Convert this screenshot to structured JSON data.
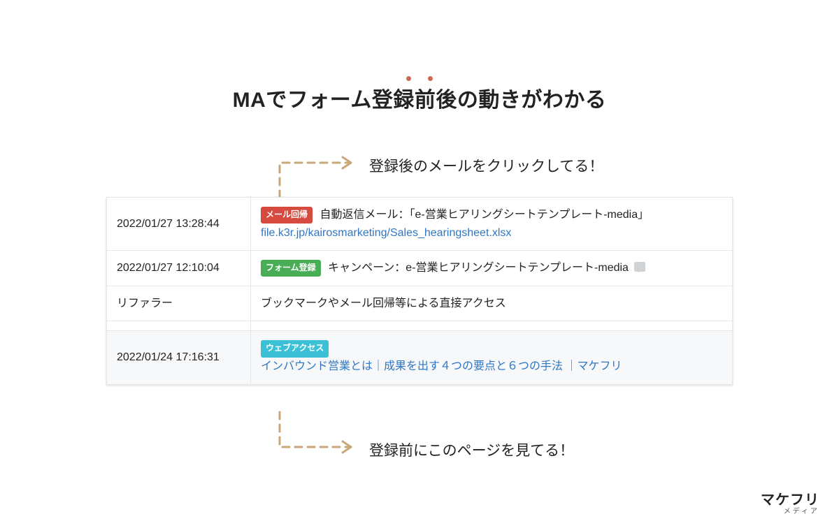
{
  "title": "MAでフォーム登録前後の動きがわかる",
  "annotations": {
    "top": "登録後のメールをクリックしてる！",
    "bottom": "登録前にこのページを見てる！"
  },
  "tags": {
    "mail_return": "メール回帰",
    "form_register": "フォーム登録",
    "web_access": "ウェブアクセス"
  },
  "rows": {
    "r1": {
      "ts": "2022/01/27 13:28:44",
      "desc": "自動返信メール：「e-営業ヒアリングシートテンプレート-media」",
      "link": "file.k3r.jp/kairosmarketing/Sales_hearingsheet.xlsx"
    },
    "r2": {
      "ts": "2022/01/27 12:10:04",
      "desc": "キャンペーン：e-営業ヒアリングシートテンプレート-media"
    },
    "r3": {
      "label": "リファラー",
      "desc": "ブックマークやメール回帰等による直接アクセス"
    },
    "r4": {
      "ts": "2022/01/24 17:16:31",
      "link": "インバウンド営業とは｜成果を出す４つの要点と６つの手法 ｜マケフリ"
    }
  },
  "brand": {
    "name": "マケフリ",
    "sub": "メディア"
  },
  "colors": {
    "arrow": "#caa776"
  }
}
